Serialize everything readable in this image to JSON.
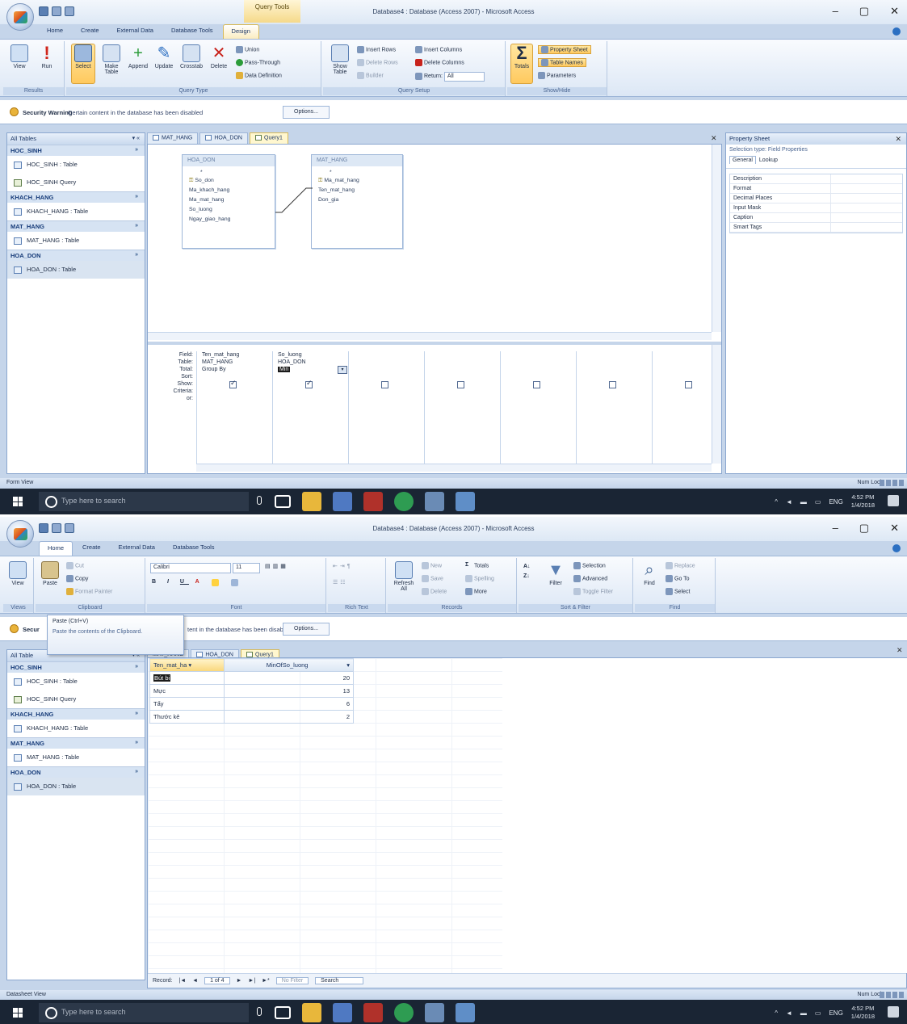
{
  "ribbon_tabs": {
    "home": "Home",
    "create": "Create",
    "external": "External Data",
    "dbtools": "Database Tools",
    "design": "Design"
  },
  "screen1": {
    "window_title": "Database4 : Database (Access 2007) - Microsoft Access",
    "context_tab": "Query Tools",
    "groups": {
      "results": "Results",
      "query_type": "Query Type",
      "query_setup": "Query Setup",
      "show_hide": "Show/Hide"
    },
    "results_buttons": {
      "view": "View",
      "run": "Run"
    },
    "query_type_buttons": {
      "select": "Select",
      "make_table": "Make Table",
      "append": "Append",
      "update": "Update",
      "crosstab": "Crosstab",
      "delete": "Delete",
      "union": "Union",
      "pass_through": "Pass-Through",
      "data_definition": "Data Definition"
    },
    "setup_buttons": {
      "show_table": "Show Table",
      "insert_rows": "Insert Rows",
      "delete_rows": "Delete Rows",
      "builder": "Builder",
      "insert_columns": "Insert Columns",
      "delete_columns": "Delete Columns",
      "return": "Return:",
      "return_value": "All"
    },
    "show_hide_buttons": {
      "totals": "Totals",
      "property_sheet": "Property Sheet",
      "table_names": "Table Names",
      "parameters": "Parameters"
    },
    "status_left": "Form View",
    "field_lists": [
      {
        "title": "HOA_DON",
        "fields": [
          "Ma_khach_hang",
          "Ma_mat_hang",
          "So_luong",
          "Ngay_giao_hang"
        ],
        "pk": "So_don"
      },
      {
        "title": "MAT_HANG",
        "fields": [
          "Ten_mat_hang",
          "Don_gia"
        ],
        "pk": "Ma_mat_hang"
      }
    ],
    "qbe": {
      "row_labels": [
        "Field:",
        "Table:",
        "Total:",
        "Sort:",
        "Show:",
        "Criteria:",
        "or:"
      ],
      "columns": [
        {
          "field": "Ten_mat_hang",
          "table": "MAT_HANG",
          "total": "Group By",
          "show": true
        },
        {
          "field": "So_luong",
          "table": "HOA_DON",
          "total": "Min",
          "show": true
        },
        {
          "show": false
        },
        {
          "show": false
        },
        {
          "show": false
        },
        {
          "show": false
        },
        {
          "show": false
        }
      ]
    },
    "property_sheet": {
      "title": "Property Sheet",
      "selection_type": "Selection type: Field Properties",
      "tab_general": "General",
      "tab_lookup": "Lookup",
      "props": [
        "Description",
        "Format",
        "Decimal Places",
        "Input Mask",
        "Caption",
        "Smart Tags"
      ]
    }
  },
  "screen2": {
    "window_title": "Database4 : Database (Access 2007) - Microsoft Access",
    "groups": {
      "views": "Views",
      "clipboard": "Clipboard",
      "font": "Font",
      "rich_text": "Rich Text",
      "records": "Records",
      "sort_filter": "Sort & Filter",
      "find": "Find"
    },
    "home_buttons": {
      "view": "View",
      "paste": "Paste",
      "cut": "Cut",
      "copy": "Copy",
      "format_painter": "Format Painter",
      "font_name": "Calibri",
      "font_size": "11",
      "refresh": "Refresh All",
      "new": "New",
      "save": "Save",
      "delete": "Delete",
      "totals": "Totals",
      "spelling": "Spelling",
      "more": "More",
      "filter": "Filter",
      "selection": "Selection",
      "advanced": "Advanced",
      "toggle_filter": "Toggle Filter",
      "find": "Find",
      "replace": "Replace",
      "goto": "Go To",
      "select": "Select"
    },
    "tooltip": {
      "title": "Paste (Ctrl+V)",
      "body": "Paste the contents of the Clipboard."
    },
    "security_prefix": "Secur",
    "security_suffix": "tent in the database has been disabled",
    "status_left": "Datasheet View",
    "datasheet": {
      "headers": [
        "Ten_mat_ha",
        "MinOfSo_luong"
      ],
      "rows": [
        {
          "name": "Bút bi",
          "value": "20"
        },
        {
          "name": "Mực",
          "value": "13"
        },
        {
          "name": "Tẩy",
          "value": "6"
        },
        {
          "name": "Thước kẻ",
          "value": "2"
        }
      ]
    },
    "record_nav": {
      "label": "Record:",
      "position": "1 of 4",
      "filter": "No Filter",
      "search": "Search"
    }
  },
  "common": {
    "nav_title": "All Tables",
    "nav_title_short": "All Table",
    "nav_groups": [
      {
        "name": "HOC_SINH",
        "items": [
          {
            "label": "HOC_SINH : Table",
            "kind": "table"
          },
          {
            "label": "HOC_SINH Query",
            "kind": "query"
          }
        ]
      },
      {
        "name": "KHACH_HANG",
        "items": [
          {
            "label": "KHACH_HANG : Table",
            "kind": "table"
          }
        ]
      },
      {
        "name": "MAT_HANG",
        "items": [
          {
            "label": "MAT_HANG : Table",
            "kind": "table"
          }
        ]
      },
      {
        "name": "HOA_DON",
        "items": [
          {
            "label": "HOA_DON : Table",
            "kind": "table"
          }
        ]
      }
    ],
    "doc_tabs": [
      "MAT_HANG",
      "HOA_DON",
      "Query1"
    ],
    "security_title": "Security Warning",
    "security_text": "Certain content in the database has been disabled",
    "options_button": "Options...",
    "status_right": "Num Lock",
    "taskbar_search": "Type here to search",
    "tray_lang": "ENG",
    "clock_time": "4:52 PM",
    "clock_date": "1/4/2018"
  }
}
